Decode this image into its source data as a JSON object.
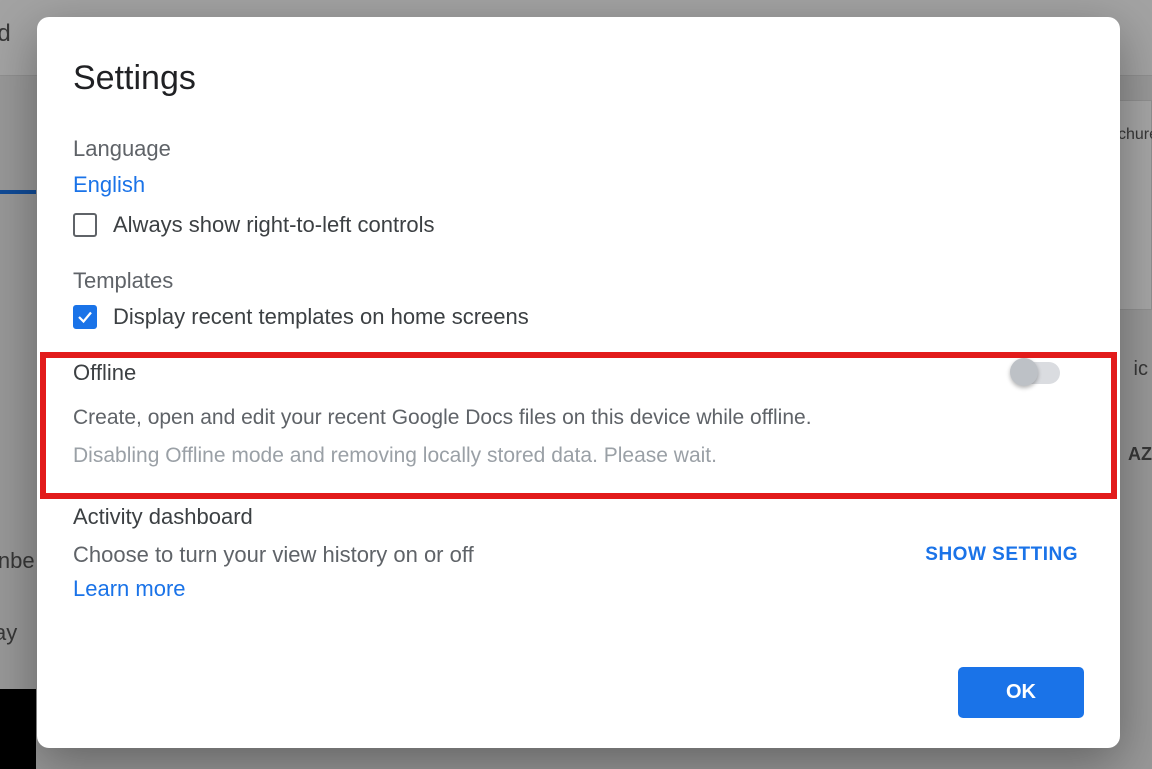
{
  "dialog": {
    "title": "Settings"
  },
  "language": {
    "heading": "Language",
    "current": "English",
    "rtl_label": "Always show right-to-left controls",
    "rtl_checked": false
  },
  "templates": {
    "heading": "Templates",
    "display_label": "Display recent templates on home screens",
    "display_checked": true
  },
  "offline": {
    "heading": "Offline",
    "description": "Create, open and edit your recent Google Docs files on this device while offline.",
    "status": "Disabling Offline mode and removing locally stored data. Please wait.",
    "enabled": false
  },
  "activity": {
    "heading": "Activity dashboard",
    "description": "Choose to turn your view history on or off",
    "learn_more": "Learn more",
    "show_setting": "SHOW SETTING"
  },
  "footer": {
    "ok": "OK"
  },
  "background": {
    "frag_top": "ew d",
    "frag_unbe": "Unbe",
    "frag_ay": "ay",
    "frag_chure": "chure",
    "frag_ic": "ic",
    "frag_az": "AZ"
  }
}
